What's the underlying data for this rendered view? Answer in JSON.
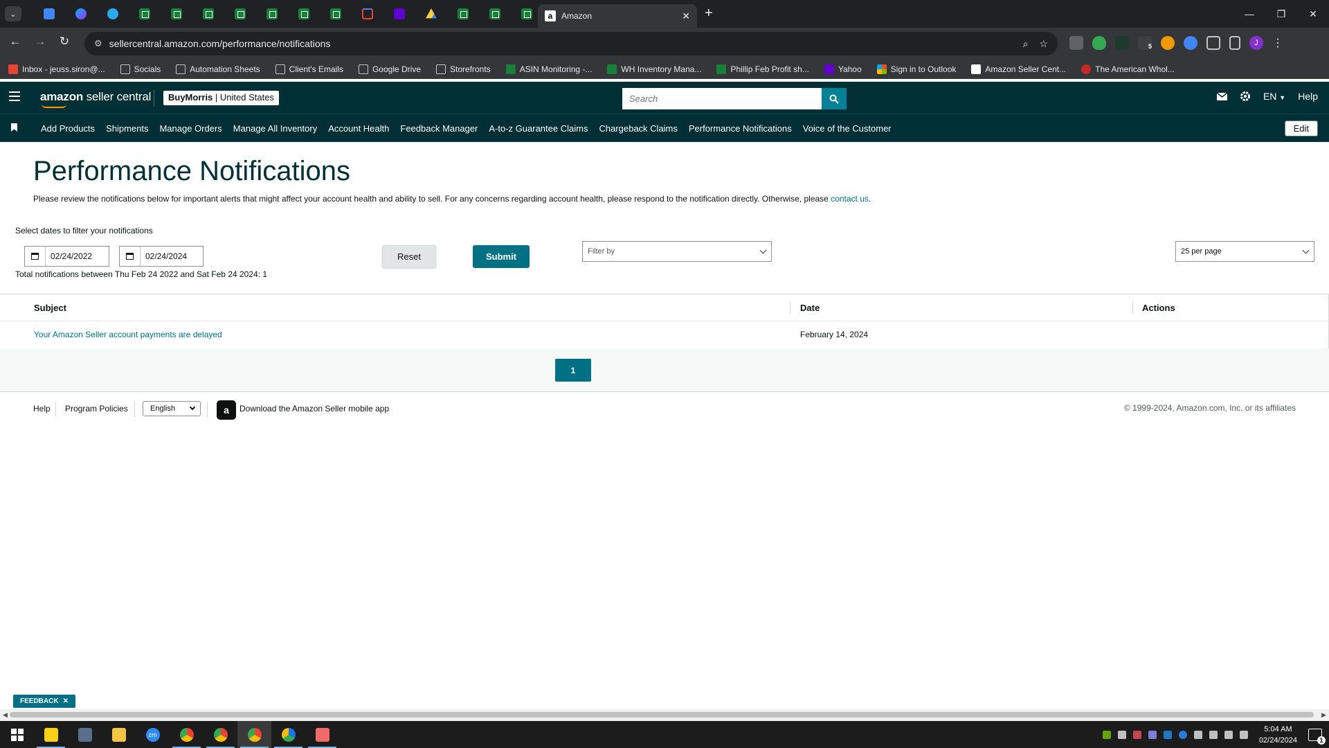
{
  "browser": {
    "active_tab_title": "Amazon",
    "url": "sellercentral.amazon.com/performance/notifications",
    "pinned_tabs": [
      "docs-icon",
      "messenger-icon",
      "telegram-icon",
      "sheets-icon",
      "sheets-icon",
      "sheets-icon",
      "sheets-icon",
      "sheets-icon",
      "sheets-icon",
      "sheets-icon",
      "gmail-icon",
      "yahoo-mail-icon",
      "google-drive-icon",
      "sheets-icon",
      "sheets-icon",
      "sheets-icon"
    ],
    "profile_initial": "J",
    "extension_badge": "5",
    "bookmarks": [
      {
        "label": "Inbox - jeuss.siron@...",
        "icon": "gmail-icon"
      },
      {
        "label": "Socials",
        "icon": "folder-icon"
      },
      {
        "label": "Automation Sheets",
        "icon": "folder-icon"
      },
      {
        "label": "Client's Emails",
        "icon": "folder-icon"
      },
      {
        "label": "Google Drive",
        "icon": "folder-icon"
      },
      {
        "label": "Storefronts",
        "icon": "folder-icon"
      },
      {
        "label": "ASIN Monitoring -...",
        "icon": "sheets-icon"
      },
      {
        "label": "WH Inventory Mana...",
        "icon": "sheets-icon"
      },
      {
        "label": "Phillip Feb Profit sh...",
        "icon": "sheets-icon"
      },
      {
        "label": "Yahoo",
        "icon": "yahoo-icon"
      },
      {
        "label": "Sign in to Outlook",
        "icon": "microsoft-icon"
      },
      {
        "label": "Amazon Seller Cent...",
        "icon": "amazon-icon"
      },
      {
        "label": "The American Whol...",
        "icon": "site-icon"
      }
    ]
  },
  "header": {
    "logo_brand": "amazon",
    "logo_product": "seller central",
    "store": "BuyMorris",
    "marketplace": "United States",
    "search_placeholder": "Search",
    "language": "EN",
    "help": "Help"
  },
  "subnav": {
    "items": [
      "Add Products",
      "Shipments",
      "Manage Orders",
      "Manage All Inventory",
      "Account Health",
      "Feedback Manager",
      "A-to-z Guarantee Claims",
      "Chargeback Claims",
      "Performance Notifications",
      "Voice of the Customer"
    ],
    "edit": "Edit"
  },
  "main": {
    "title": "Performance Notifications",
    "description": "Please review the notifications below for important alerts that might affect your account health and ability to sell. For any concerns regarding account health, please respond to the notification directly. Otherwise, please ",
    "contact_link": "contact us",
    "description_end": ".",
    "filter_label": "Select dates to filter your notifications",
    "date_from": "02/24/2022",
    "date_to": "02/24/2024",
    "reset": "Reset",
    "submit": "Submit",
    "filter_by_placeholder": "Filter by",
    "per_page": "25 per page",
    "totals": "Total notifications between Thu Feb 24 2022 and Sat Feb 24 2024: 1"
  },
  "table": {
    "columns": [
      "Subject",
      "Date",
      "Actions"
    ],
    "rows": [
      {
        "subject": "Your Amazon Seller account payments are delayed",
        "date": "February 14, 2024",
        "actions": ""
      }
    ]
  },
  "pagination": {
    "current_page": "1"
  },
  "footer": {
    "help": "Help",
    "policies": "Program Policies",
    "language": "English",
    "app_text": "Download the Amazon Seller mobile app",
    "copyright": "© 1999-2024, Amazon.com, Inc. or its affiliates"
  },
  "feedback": {
    "label": "FEEDBACK"
  },
  "taskbar": {
    "time": "5:04 AM",
    "date": "02/24/2024",
    "notification_count": "1",
    "apps": [
      "start-icon",
      "sticky-notes-icon",
      "calculator-icon",
      "file-explorer-icon",
      "zoom-icon",
      "chrome-icon",
      "chrome-icon",
      "chrome-icon",
      "chrome-beta-icon",
      "app-icon"
    ]
  },
  "colors": {
    "header_bg": "#002f36",
    "accent": "#007185",
    "link": "#007185",
    "title": "#002f36"
  }
}
